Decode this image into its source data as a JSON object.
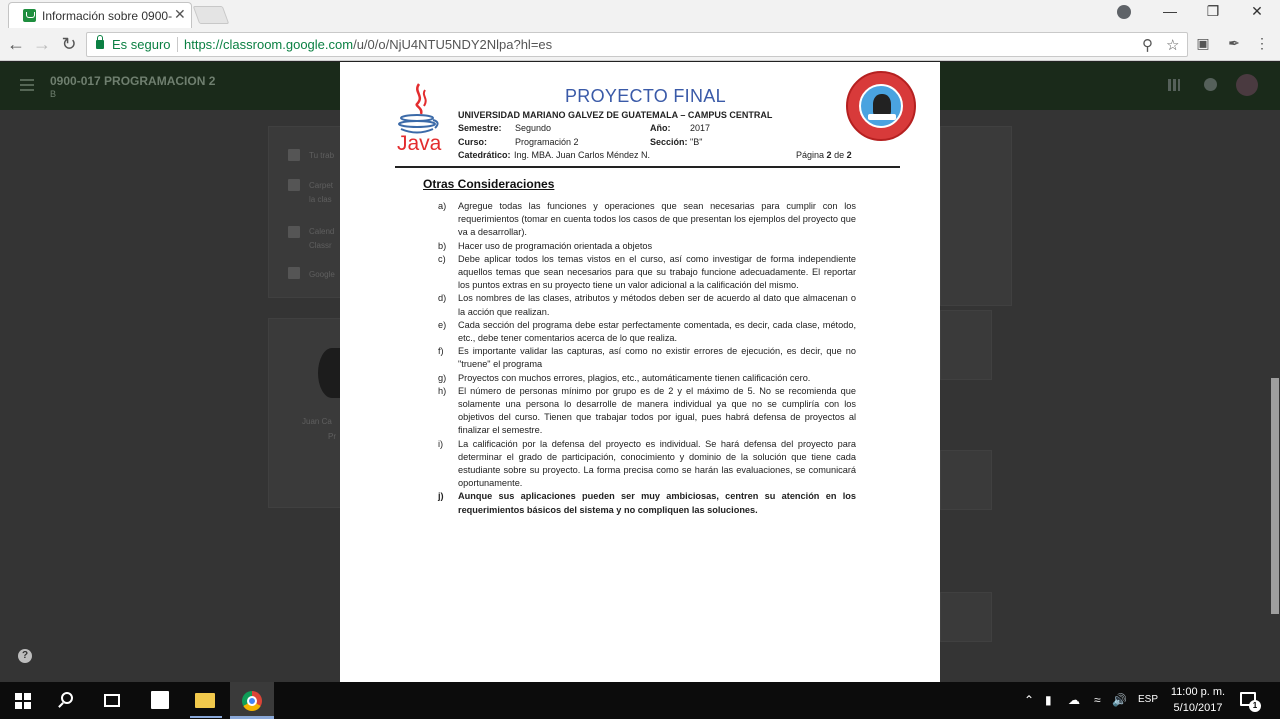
{
  "browser": {
    "tab_title": "Información sobre 0900-",
    "tab_close": "✕",
    "secure_label": "Es seguro",
    "url_scheme_host": "https://classroom.google.com",
    "url_path": "/u/0/o/NjU4NTU5NDY2Nlpa?hl=es"
  },
  "classroom": {
    "course_title": "0900-017 PROGRAMACION 2",
    "course_sub": "B",
    "sidebar_items": [
      "Tu trab",
      "Carpet",
      "la clas",
      "Calend",
      "Classr",
      "Google"
    ],
    "teacher_name": "Juan Ca",
    "teacher_role": "Pr"
  },
  "document": {
    "logo_text": "Java",
    "title": "PROYECTO FINAL",
    "university": "UNIVERSIDAD MARIANO GALVEZ DE GUATEMALA – CAMPUS CENTRAL",
    "semestre_label": "Semestre:",
    "semestre_value": "Segundo",
    "anio_label": "Año:",
    "anio_value": "2017",
    "curso_label": "Curso:",
    "curso_value": "Programación 2",
    "seccion_label": "Sección:",
    "seccion_value": "\"B\"",
    "catedratico_label": "Catedrático:",
    "catedratico_value": "Ing. MBA. Juan Carlos Méndez N.",
    "pagina_prefix": "Página",
    "pagina_num": "2",
    "pagina_de": "de",
    "pagina_total": "2",
    "heading": "Otras Consideraciones",
    "items": [
      {
        "letter": "a)",
        "text": "Agregue todas las funciones y operaciones que sean necesarias para cumplir con los requerimientos (tomar en cuenta todos los casos de que presentan los ejemplos del proyecto que va a desarrollar)."
      },
      {
        "letter": "b)",
        "text": "Hacer uso de programación orientada a objetos"
      },
      {
        "letter": "c)",
        "text": "Debe aplicar todos los temas vistos en el curso, así como investigar de forma independiente aquellos temas que sean necesarios para que su trabajo funcione adecuadamente. El reportar los puntos extras en su proyecto tiene un valor adicional a la calificación del mismo."
      },
      {
        "letter": "d)",
        "text": "Los nombres de las clases, atributos y métodos deben ser de acuerdo al dato que almacenan o la acción que realizan."
      },
      {
        "letter": "e)",
        "text": "Cada sección del programa debe estar perfectamente comentada, es decir, cada clase, método, etc., debe tener comentarios acerca de lo que realiza."
      },
      {
        "letter": "f)",
        "text": "Es importante validar las capturas, así como no existir errores de ejecución, es decir, que no \"truene\" el programa"
      },
      {
        "letter": "g)",
        "text": "Proyectos con muchos errores, plagios, etc., automáticamente tienen calificación cero."
      },
      {
        "letter": "h)",
        "text": "El número de personas mínimo por grupo es de 2 y el máximo de 5.  No se recomienda que solamente una persona lo desarrolle de manera individual ya que no se cumpliría con los objetivos del curso. Tienen que trabajar todos por igual, pues habrá defensa de proyectos al finalizar el semestre."
      },
      {
        "letter": "i)",
        "text": "La calificación por la defensa del proyecto es individual. Se hará defensa del proyecto para determinar el grado de participación, conocimiento y dominio de la solución que tiene cada estudiante sobre su proyecto. La forma precisa como se harán las evaluaciones, se comunicará oportunamente."
      },
      {
        "letter": "j)",
        "text": "Aunque sus aplicaciones pueden ser muy ambiciosas, centren su atención en los requerimientos básicos del sistema y no compliquen las soluciones."
      }
    ]
  },
  "taskbar": {
    "language": "ESP",
    "time": "11:00 p. m.",
    "date": "5/10/2017",
    "notification_count": "1",
    "help_label": "?"
  }
}
